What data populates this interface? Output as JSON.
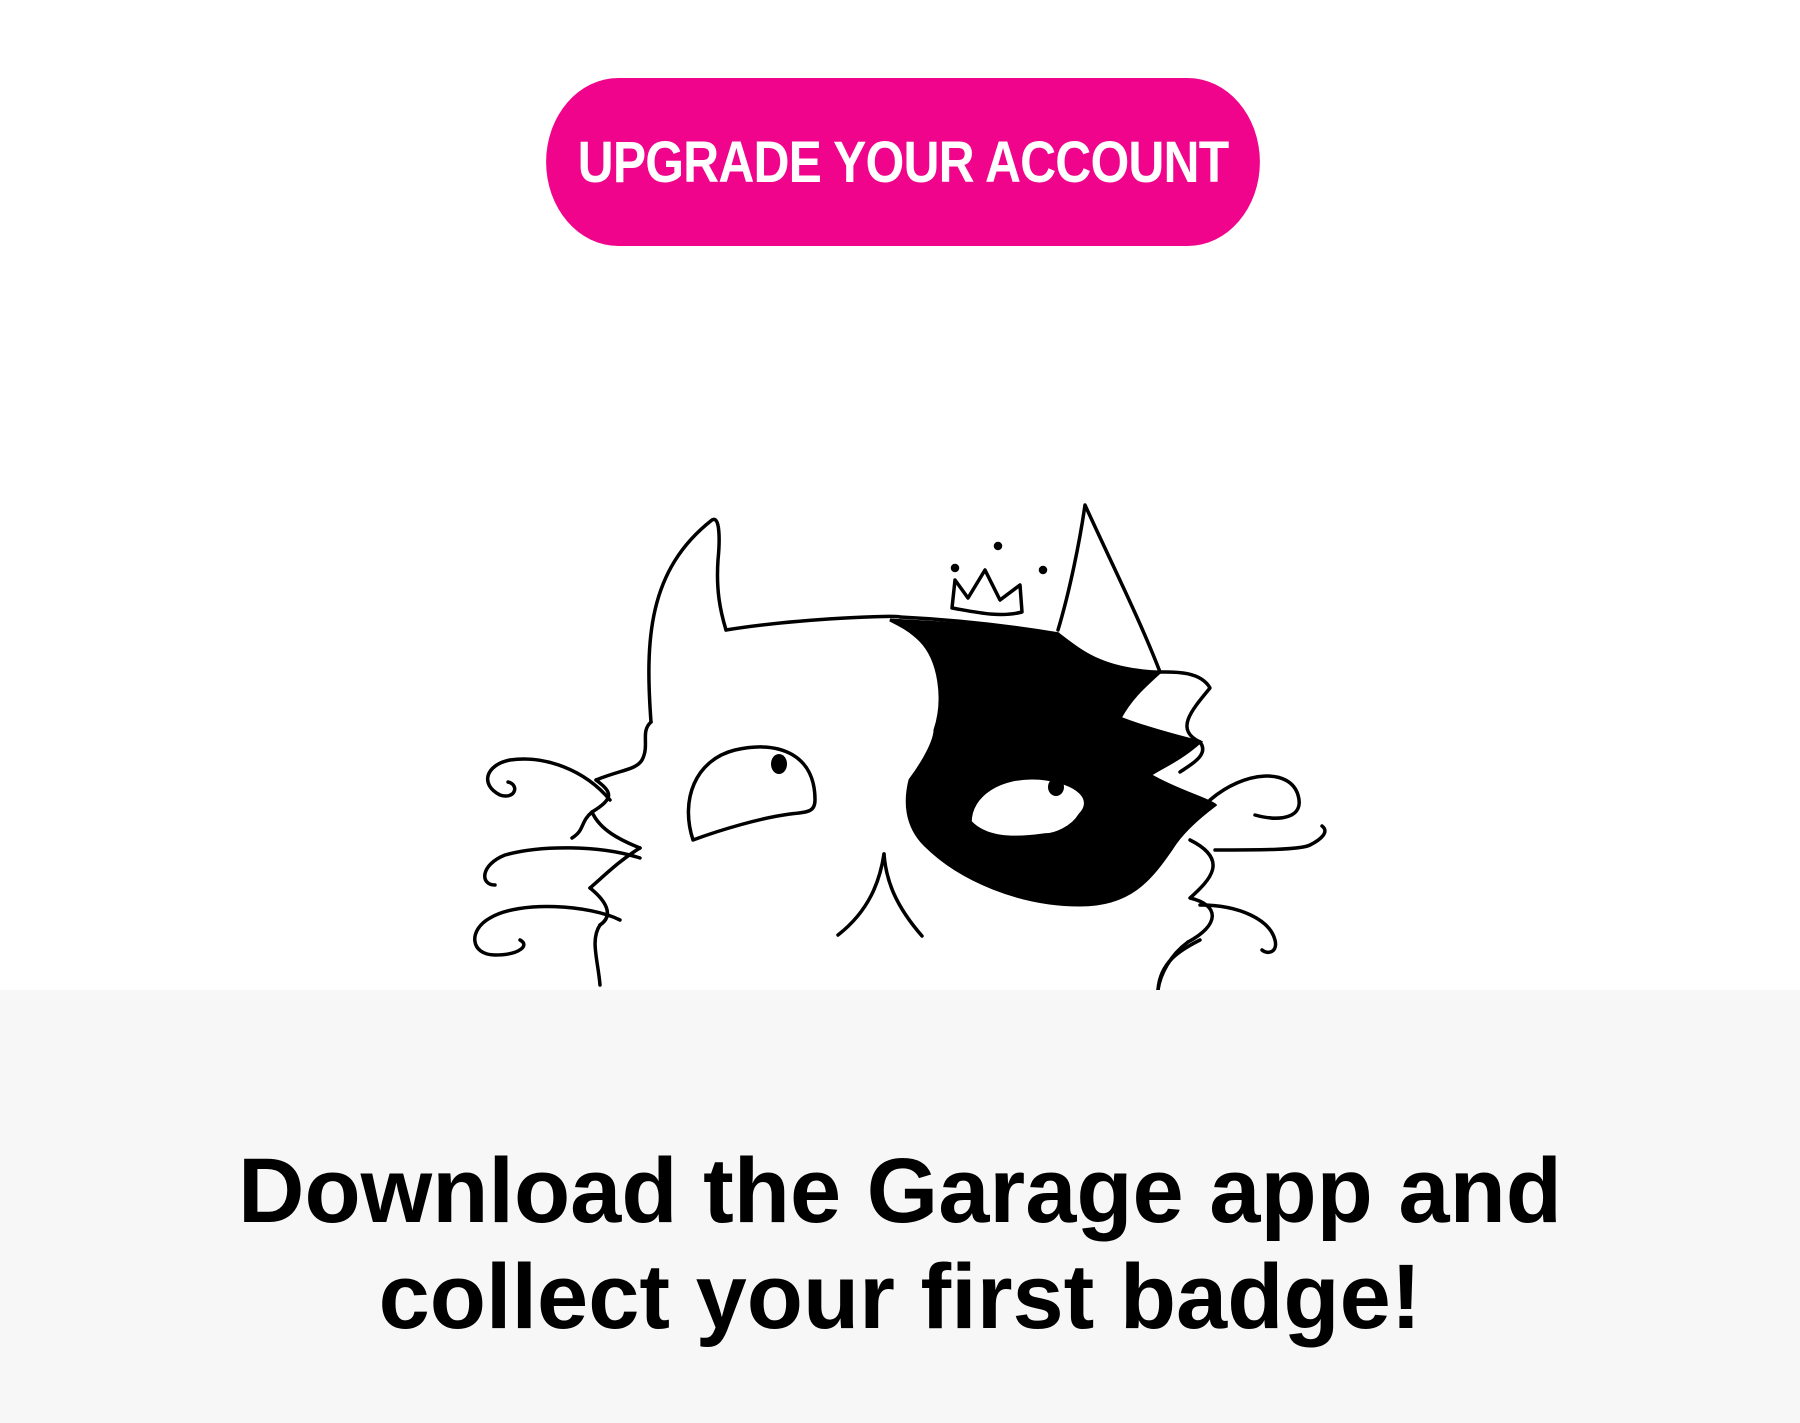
{
  "upgrade_button": {
    "label": "UPGRADE YOUR ACCOUNT",
    "color": "#f0048c"
  },
  "illustration": {
    "icon": "cat-with-crown-icon"
  },
  "promo": {
    "line1": "Download the Garage app and",
    "line2": "collect your first badge!",
    "background": "#f7f7f7"
  }
}
